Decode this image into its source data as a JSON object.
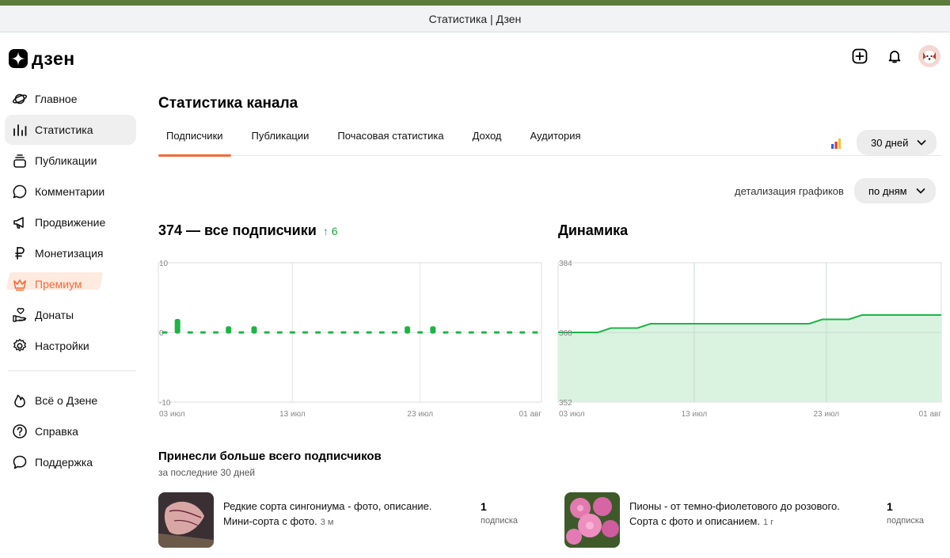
{
  "window": {
    "title": "Статистика | Дзен"
  },
  "brand": {
    "logo_text": "дзен"
  },
  "header": {
    "icons": [
      "add-icon",
      "bell-icon",
      "avatar"
    ]
  },
  "sidebar": {
    "items": [
      {
        "label": "Главное",
        "icon": "planet-icon"
      },
      {
        "label": "Статистика",
        "icon": "bars-icon"
      },
      {
        "label": "Публикации",
        "icon": "stack-icon"
      },
      {
        "label": "Комментарии",
        "icon": "comment-icon"
      },
      {
        "label": "Продвижение",
        "icon": "megaphone-icon"
      },
      {
        "label": "Монетизация",
        "icon": "ruble-icon"
      },
      {
        "label": "Премиум",
        "icon": "crown-icon"
      },
      {
        "label": "Донаты",
        "icon": "donate-icon"
      },
      {
        "label": "Настройки",
        "icon": "gear-icon"
      }
    ],
    "bottom_items": [
      {
        "label": "Всё о Дзене",
        "icon": "flame-icon"
      },
      {
        "label": "Справка",
        "icon": "help-icon"
      },
      {
        "label": "Поддержка",
        "icon": "support-icon"
      }
    ]
  },
  "page": {
    "title": "Статистика канала",
    "tabs": [
      "Подписчики",
      "Публикации",
      "Почасовая статистика",
      "Доход",
      "Аудитория"
    ],
    "active_tab": 0,
    "period": "30 дней",
    "detail_label": "детализация графиков",
    "detail_value": "по дням"
  },
  "subscribers": {
    "title": "374 — все подписчики",
    "growth": "↑ 6"
  },
  "dynamics": {
    "title": "Динамика"
  },
  "colors": {
    "accent": "#f26b3a",
    "green": "#1db446",
    "green_fill": "#d9f3e0"
  },
  "chart_data": [
    {
      "type": "bar",
      "title": "374 — все подписчики",
      "x_ticks": [
        "03 июл",
        "13 июл",
        "23 июл",
        "01 авг"
      ],
      "y_ticks": [
        "10",
        "0",
        "-10"
      ],
      "ylim": [
        -10,
        10
      ],
      "values": [
        0,
        2,
        0,
        0,
        0,
        1,
        0,
        1,
        0,
        0,
        0,
        0,
        0,
        0,
        0,
        0,
        0,
        0,
        0,
        1,
        0,
        1,
        0,
        0,
        0,
        0,
        0,
        0,
        0,
        0
      ],
      "grid": true
    },
    {
      "type": "area",
      "title": "Динамика",
      "x_ticks": [
        "03 июл",
        "13 июл",
        "23 июл",
        "01 авг"
      ],
      "y_ticks": [
        "384",
        "368",
        "352"
      ],
      "ylim": [
        352,
        384
      ],
      "values": [
        368,
        368,
        368,
        368,
        369,
        369,
        369,
        370,
        370,
        370,
        370,
        370,
        370,
        370,
        370,
        370,
        370,
        370,
        370,
        370,
        371,
        371,
        371,
        372,
        372,
        372,
        372,
        372,
        372,
        372
      ],
      "grid": true
    }
  ],
  "best": {
    "title": "Принесли больше всего подписчиков",
    "subtitle": "за последние 30 дней",
    "items": [
      {
        "text": "Редкие сорта сингониума - фото, описание. Мини-сорта с фото.",
        "age": "3 м",
        "count": "1",
        "count_label": "подписка"
      },
      {
        "text": "Пионы - от темно-фиолетового до розового. Сорта с фото и описанием.",
        "age": "1 г",
        "count": "1",
        "count_label": "подписка"
      }
    ]
  }
}
